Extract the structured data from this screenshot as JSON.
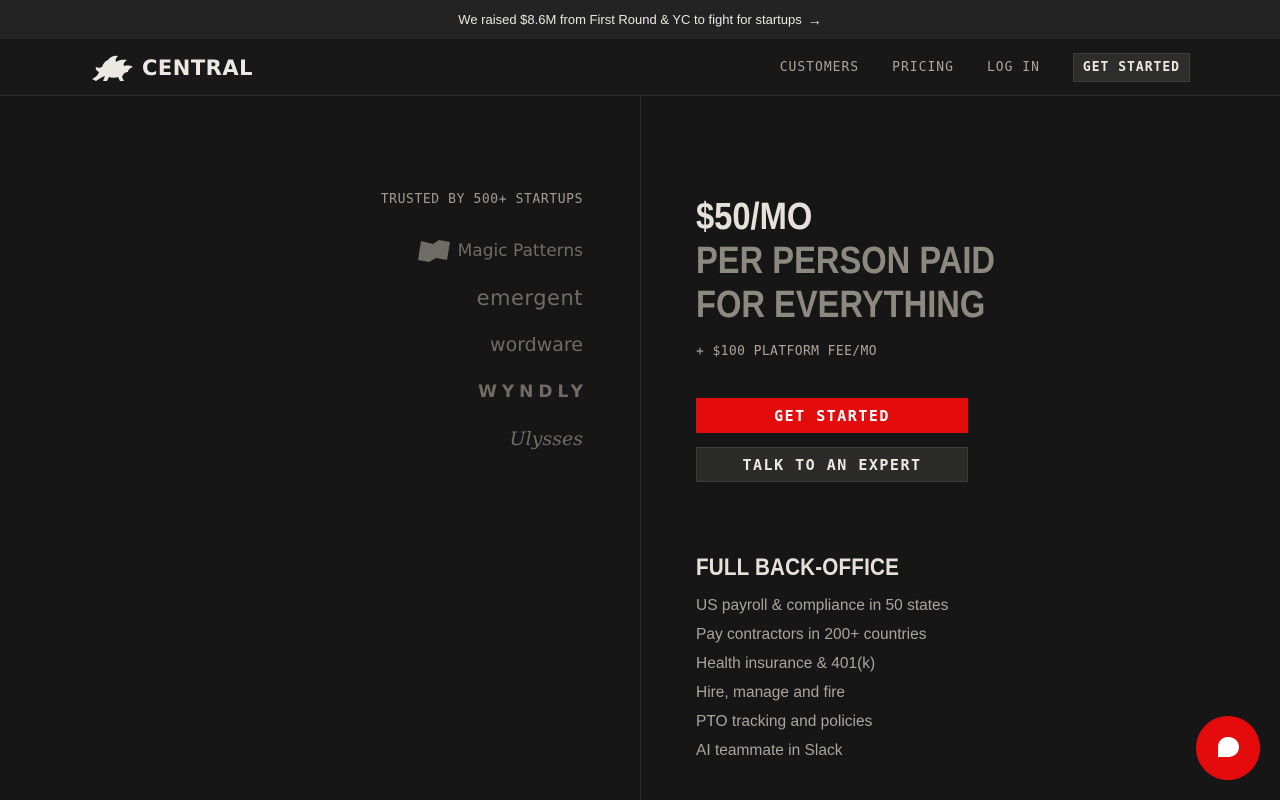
{
  "announcement": {
    "text": "We raised $8.6M from First Round & YC to fight for startups",
    "arrow": "→"
  },
  "nav": {
    "brand": "CENTRAL",
    "links": [
      "CUSTOMERS",
      "PRICING",
      "LOG IN"
    ],
    "cta": "GET STARTED"
  },
  "trusted": {
    "label": "TRUSTED BY 500+ STARTUPS",
    "brands": [
      "Magic Patterns",
      "emergent",
      "wordware",
      "WYNDLY",
      "Ulysses"
    ]
  },
  "pricing": {
    "price": "$50/MO",
    "line1": "PER PERSON PAID",
    "line2": "FOR EVERYTHING",
    "fee": "+ $100 PLATFORM FEE/MO",
    "primary_cta": "GET STARTED",
    "secondary_cta": "TALK TO AN EXPERT"
  },
  "features": {
    "title": "FULL BACK-OFFICE",
    "items": [
      "US payroll & compliance in 50 states",
      "Pay contractors in 200+ countries",
      "Health insurance & 401(k)",
      "Hire, manage and fire",
      "PTO tracking and policies",
      "AI teammate in Slack"
    ]
  },
  "colors": {
    "background": "#161616",
    "accent": "#e30b0b",
    "text": "#e5e2da",
    "muted": "#8c897f"
  },
  "icons": {
    "logo": "griffin-logo-icon",
    "chat": "chat-bubble-icon",
    "announcement": "arrow-right-icon"
  }
}
